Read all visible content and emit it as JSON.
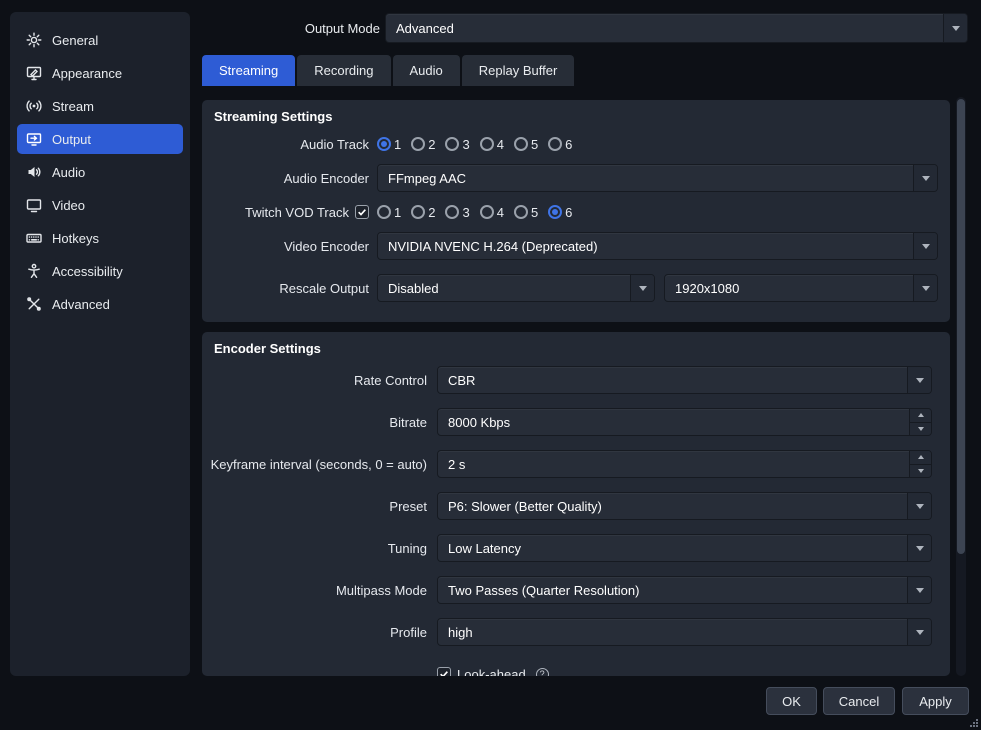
{
  "colors": {
    "accent": "#2e5cd5",
    "panel_bg": "#232934",
    "sidebar_bg": "#1c212b",
    "window_bg": "#0d1016"
  },
  "sidebar": {
    "items": [
      {
        "label": "General",
        "icon": "gear-icon"
      },
      {
        "label": "Appearance",
        "icon": "appearance-icon"
      },
      {
        "label": "Stream",
        "icon": "antenna-icon"
      },
      {
        "label": "Output",
        "icon": "output-icon",
        "selected": true
      },
      {
        "label": "Audio",
        "icon": "speaker-icon"
      },
      {
        "label": "Video",
        "icon": "display-icon"
      },
      {
        "label": "Hotkeys",
        "icon": "keyboard-icon"
      },
      {
        "label": "Accessibility",
        "icon": "accessibility-icon"
      },
      {
        "label": "Advanced",
        "icon": "tools-icon"
      }
    ]
  },
  "output_mode": {
    "label": "Output Mode",
    "value": "Advanced"
  },
  "tabs": [
    {
      "label": "Streaming",
      "active": true
    },
    {
      "label": "Recording",
      "active": false
    },
    {
      "label": "Audio",
      "active": false
    },
    {
      "label": "Replay Buffer",
      "active": false
    }
  ],
  "streaming": {
    "title": "Streaming Settings",
    "audio_track": {
      "label": "Audio Track",
      "options": [
        "1",
        "2",
        "3",
        "4",
        "5",
        "6"
      ],
      "selected": "1"
    },
    "audio_encoder": {
      "label": "Audio Encoder",
      "value": "FFmpeg AAC"
    },
    "twitch_vod": {
      "label": "Twitch VOD Track",
      "checked": true,
      "options": [
        "1",
        "2",
        "3",
        "4",
        "5",
        "6"
      ],
      "selected": "6"
    },
    "video_encoder": {
      "label": "Video Encoder",
      "value": "NVIDIA NVENC H.264 (Deprecated)"
    },
    "rescale": {
      "label": "Rescale Output",
      "mode": "Disabled",
      "resolution": "1920x1080"
    }
  },
  "encoder": {
    "title": "Encoder Settings",
    "rate_control": {
      "label": "Rate Control",
      "value": "CBR"
    },
    "bitrate": {
      "label": "Bitrate",
      "value": "8000 Kbps"
    },
    "keyframe": {
      "label": "Keyframe interval (seconds, 0 = auto)",
      "value": "2 s"
    },
    "preset": {
      "label": "Preset",
      "value": "P6: Slower (Better Quality)"
    },
    "tuning": {
      "label": "Tuning",
      "value": "Low Latency"
    },
    "multipass": {
      "label": "Multipass Mode",
      "value": "Two Passes (Quarter Resolution)"
    },
    "profile": {
      "label": "Profile",
      "value": "high"
    },
    "look_ahead": {
      "label": "Look-ahead",
      "checked": true,
      "help": "?"
    }
  },
  "footer": {
    "ok": "OK",
    "cancel": "Cancel",
    "apply": "Apply"
  }
}
